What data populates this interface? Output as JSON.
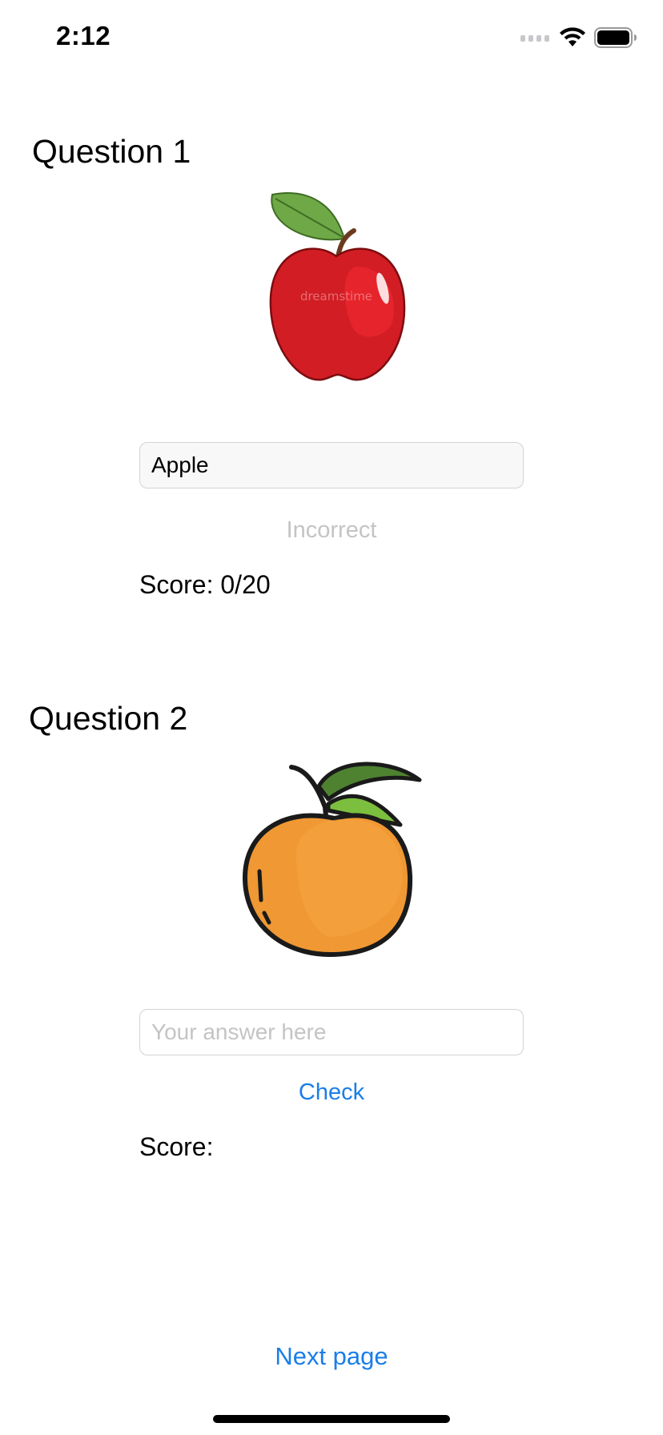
{
  "status_bar": {
    "time": "2:12",
    "icons": [
      "signal-icon",
      "wifi-icon",
      "battery-icon"
    ]
  },
  "questions": [
    {
      "title": "Question 1",
      "image": "apple-icon",
      "image_watermark": "dreamstime",
      "answer_value": "Apple",
      "answer_placeholder": "Your answer here",
      "feedback": "Incorrect",
      "score_label": "Score: 0/20"
    },
    {
      "title": "Question 2",
      "image": "orange-icon",
      "answer_value": "",
      "answer_placeholder": "Your answer here",
      "check_label": "Check",
      "score_label": "Score:"
    }
  ],
  "next_label": "Next page",
  "colors": {
    "accent": "#1a7ee8",
    "placeholder": "#c4c4c6",
    "field_border": "#d3d3d3"
  }
}
